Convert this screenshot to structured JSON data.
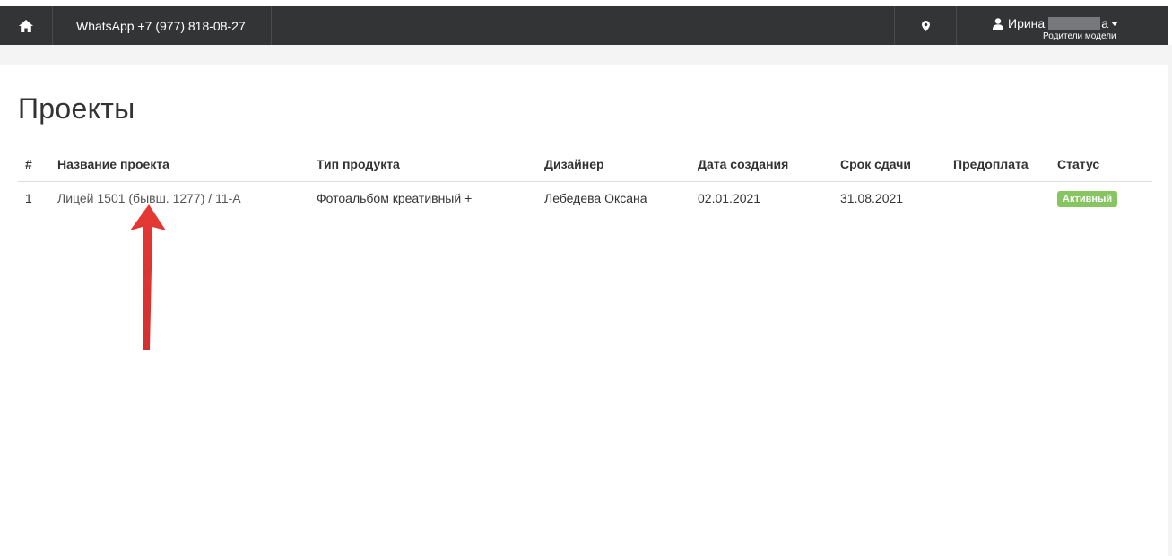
{
  "navbar": {
    "home_icon": "home-icon",
    "whatsapp_text": "WhatsApp +7 (977) 818-08-27",
    "location_icon": "map-marker-icon",
    "user": {
      "icon": "user-icon",
      "name_first": "Ирина",
      "name_last_tail": "а",
      "role": "Родители модели"
    }
  },
  "page": {
    "title": "Проекты"
  },
  "table": {
    "headers": [
      "#",
      "Название проекта",
      "Тип продукта",
      "Дизайнер",
      "Дата создания",
      "Срок сдачи",
      "Предоплата",
      "Статус"
    ],
    "rows": [
      {
        "num": "1",
        "name": "Лицей 1501 (бывш. 1277) / 11-А",
        "type": "Фотоальбом креативный +",
        "designer": "Лебедева Оксана",
        "created": "02.01.2021",
        "deadline": "31.08.2021",
        "prepay": "",
        "status": "Активный"
      }
    ]
  },
  "colors": {
    "navbar_bg": "#333436",
    "status_active": "#86c55f",
    "annotation_arrow": "#e53935"
  }
}
